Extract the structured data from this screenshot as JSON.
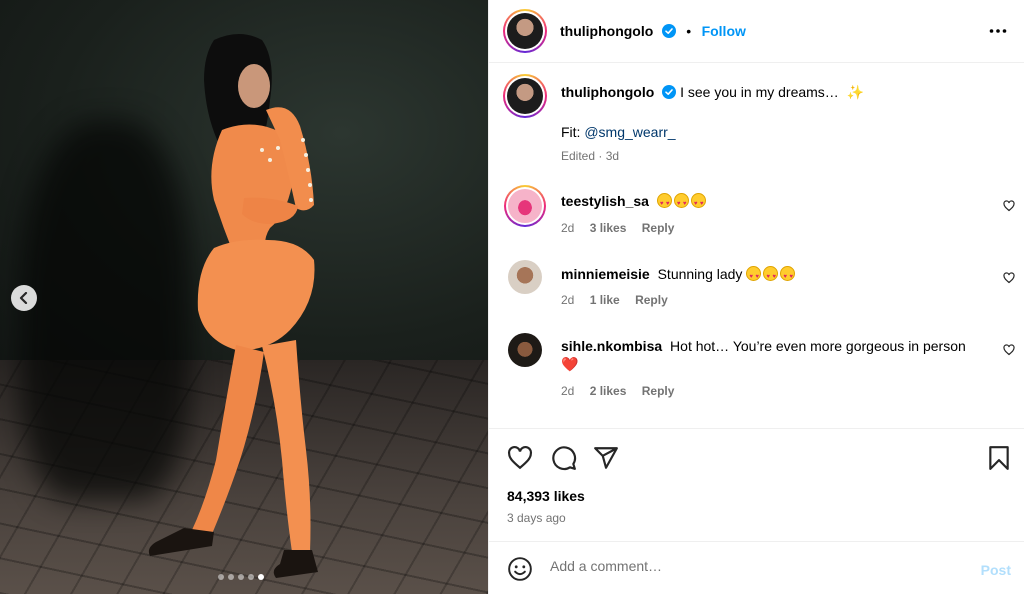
{
  "post": {
    "author": "thuliphongolo",
    "follow_label": "Follow",
    "separator": "•",
    "caption": "I see you in my dreams…",
    "sparkle": "✨",
    "fit_label": "Fit:",
    "fit_mention": "@smg_wearr_",
    "edited_time": "Edited · 3d",
    "slides": {
      "count": 5,
      "active_index": 4
    }
  },
  "comments": [
    {
      "username": "teestylish_sa",
      "text": "",
      "emoji_count": 3,
      "time": "2d",
      "likes": "3 likes",
      "reply": "Reply"
    },
    {
      "username": "minniemeisie",
      "text": "Stunning lady",
      "emoji_count": 3,
      "time": "2d",
      "likes": "1 like",
      "reply": "Reply"
    },
    {
      "username": "sihle.nkombisa",
      "text": "Hot hot… You’re even more gorgeous in person",
      "heart": "❤️",
      "time": "2d",
      "likes": "2 likes",
      "reply": "Reply"
    }
  ],
  "footer": {
    "likes": "84,393 likes",
    "time_ago": "3 days ago",
    "comment_placeholder": "Add a comment…",
    "post_label": "Post"
  },
  "icons": {
    "prev": "chevron-left-icon",
    "more": "more-horizontal-icon",
    "verified": "verified-badge-icon",
    "like": "heart-outline-icon",
    "comment": "comment-bubble-icon",
    "share": "paper-plane-icon",
    "save": "bookmark-icon",
    "emoji": "smiley-face-icon"
  },
  "colors": {
    "accent": "#0095f6",
    "muted": "#737373",
    "mention": "#00376b",
    "post_disabled": "#b2dffc",
    "outfit": "#f08a4b"
  }
}
